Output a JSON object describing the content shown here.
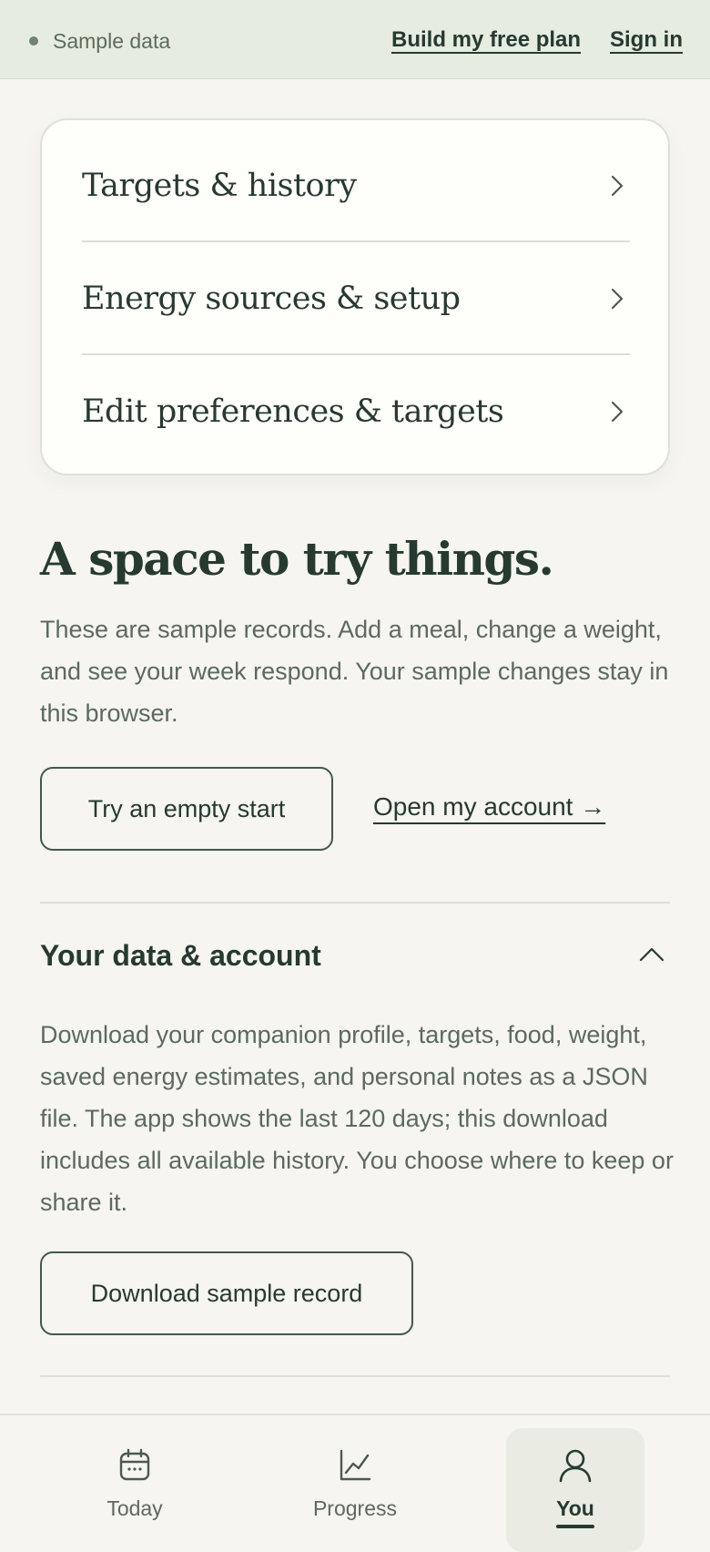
{
  "topbar": {
    "sample_label": "Sample data",
    "build_plan": "Build my free plan",
    "sign_in": "Sign in"
  },
  "menu": {
    "items": [
      {
        "label": "Targets & history",
        "icon": "chevron-right-icon"
      },
      {
        "label": "Energy sources & setup",
        "icon": "chevron-right-icon"
      },
      {
        "label": "Edit preferences & targets",
        "icon": "chevron-right-icon"
      }
    ]
  },
  "hero": {
    "title": "A space to try things.",
    "body": "These are sample records. Add a meal, change a weight, and see your week respond. Your sample changes stay in this browser.",
    "try_empty": "Try an empty start",
    "open_account": "Open my account →"
  },
  "data_section": {
    "title": "Your data & account",
    "body": "Download your companion profile, targets, food, weight, saved energy estimates, and personal notes as a JSON file. The app shows the last 120 days; this download includes all available history. You choose where to keep or share it.",
    "download": "Download sample record",
    "expanded": true
  },
  "bottom_nav": {
    "items": [
      {
        "label": "Today",
        "icon": "calendar-icon"
      },
      {
        "label": "Progress",
        "icon": "chart-icon"
      },
      {
        "label": "You",
        "icon": "user-icon",
        "active": true
      }
    ]
  },
  "colors": {
    "accent": "#263a30",
    "muted": "#5b6a5f",
    "topbar_bg": "#e6ecdf",
    "page_bg": "#f6f5f0"
  }
}
